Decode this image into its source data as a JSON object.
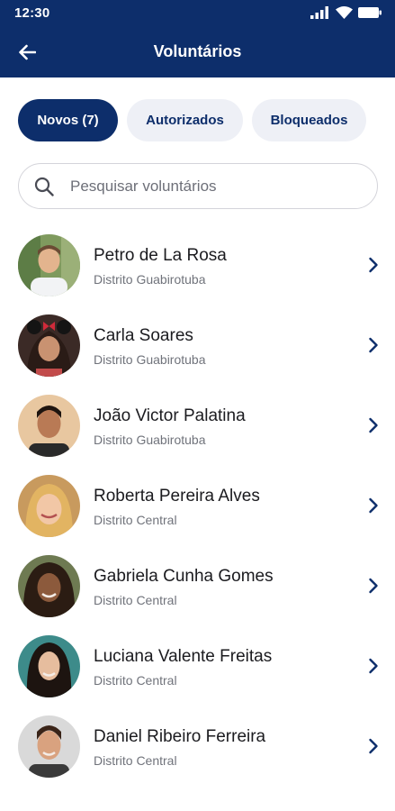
{
  "status_bar": {
    "time": "12:30"
  },
  "header": {
    "title": "Voluntários"
  },
  "tabs": [
    {
      "label": "Novos (7)",
      "active": true
    },
    {
      "label": "Autorizados",
      "active": false
    },
    {
      "label": "Bloqueados",
      "active": false
    }
  ],
  "search": {
    "placeholder": "Pesquisar voluntários",
    "value": ""
  },
  "volunteers": [
    {
      "name": "Petro de La Rosa",
      "district": "Distrito Guabirotuba"
    },
    {
      "name": "Carla Soares",
      "district": "Distrito Guabirotuba"
    },
    {
      "name": "João Victor Palatina",
      "district": "Distrito Guabirotuba"
    },
    {
      "name": "Roberta Pereira Alves",
      "district": "Distrito Central"
    },
    {
      "name": "Gabriela Cunha Gomes",
      "district": "Distrito Central"
    },
    {
      "name": "Luciana Valente Freitas",
      "district": "Distrito Central"
    },
    {
      "name": "Daniel Ribeiro Ferreira",
      "district": "Distrito Central"
    }
  ],
  "colors": {
    "primary": "#0d2e6b",
    "tab_inactive_bg": "#eef0f6",
    "secondary_text": "#70737b"
  },
  "icons": [
    "signal-icon",
    "wifi-icon",
    "battery-icon",
    "back-arrow-icon",
    "search-icon",
    "chevron-right-icon"
  ]
}
